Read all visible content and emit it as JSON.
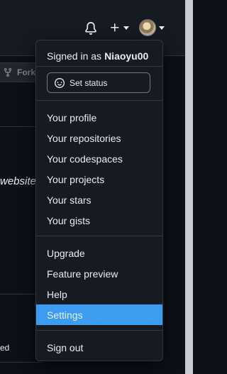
{
  "header": {
    "icons": [
      "bell-icon",
      "plus-icon",
      "avatar"
    ]
  },
  "background": {
    "fork_label": "Fork",
    "text_fragment_1": "website",
    "text_fragment_2": "ed"
  },
  "menu": {
    "signed_in_as": "Signed in as",
    "username": "Niaoyu00",
    "set_status_label": "Set status",
    "group1": [
      "Your profile",
      "Your repositories",
      "Your codespaces",
      "Your projects",
      "Your stars",
      "Your gists"
    ],
    "group2": [
      "Upgrade",
      "Feature preview",
      "Help",
      "Settings"
    ],
    "sign_out": "Sign out",
    "active_item": "Settings"
  },
  "colors": {
    "highlight": "#3b9cf0",
    "menu_bg": "#161b22",
    "page_bg": "#0d1117",
    "border": "#30363d"
  }
}
